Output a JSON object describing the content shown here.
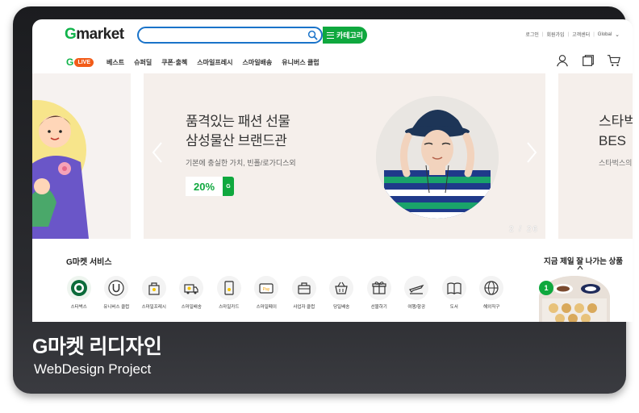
{
  "header": {
    "logo_prefix": "G",
    "logo_rest": "market",
    "search_placeholder": "",
    "category_label": "카테고리",
    "util_links": [
      "로그인",
      "회원가입",
      "고객센터",
      "Global"
    ]
  },
  "nav": {
    "live_g": "G",
    "live_label": "LIVE",
    "items": [
      "베스트",
      "슈퍼딜",
      "쿠폰·출첵",
      "스마일프레시",
      "스마일배송",
      "유니버스 클럽"
    ]
  },
  "banner": {
    "title_line1": "품격있는 패션 선물",
    "title_line2": "삼성물산 브랜드관",
    "subtitle": "기본에 충실한 가치, 빈폴/로가디스외",
    "discount": "20%",
    "discount_badge": "G",
    "pager": "2 /   26"
  },
  "banner_right": {
    "title_line1": "스타벅",
    "title_line2": "BES",
    "subtitle": "스타벅스의"
  },
  "services": {
    "title": "G마켓 서비스",
    "items": [
      {
        "label": "스타벅스",
        "icon": "starbucks-icon"
      },
      {
        "label": "유니버스 클럽",
        "icon": "universe-club-icon"
      },
      {
        "label": "스마일프레시",
        "icon": "smile-fresh-icon"
      },
      {
        "label": "스마일배송",
        "icon": "smile-delivery-icon"
      },
      {
        "label": "스마일카드",
        "icon": "smile-card-icon"
      },
      {
        "label": "스마일페이",
        "icon": "smile-pay-icon"
      },
      {
        "label": "사업자 클럽",
        "icon": "business-club-icon"
      },
      {
        "label": "당일배송",
        "icon": "same-day-delivery-icon"
      },
      {
        "label": "선물하기",
        "icon": "gift-icon"
      },
      {
        "label": "여행/항공",
        "icon": "airplane-icon"
      },
      {
        "label": "도서",
        "icon": "book-icon"
      },
      {
        "label": "해외직구",
        "icon": "globe-icon"
      }
    ]
  },
  "hot": {
    "title": "지금 제일 잘 나가는 상품",
    "rank": "1"
  },
  "caption": {
    "title": "G마켓 리디자인",
    "subtitle": "WebDesign Project"
  },
  "colors": {
    "brand_green": "#0fa83e",
    "search_blue": "#1a73c9",
    "live_orange": "#f25c19",
    "frame_dark": "#1b1c1f"
  }
}
